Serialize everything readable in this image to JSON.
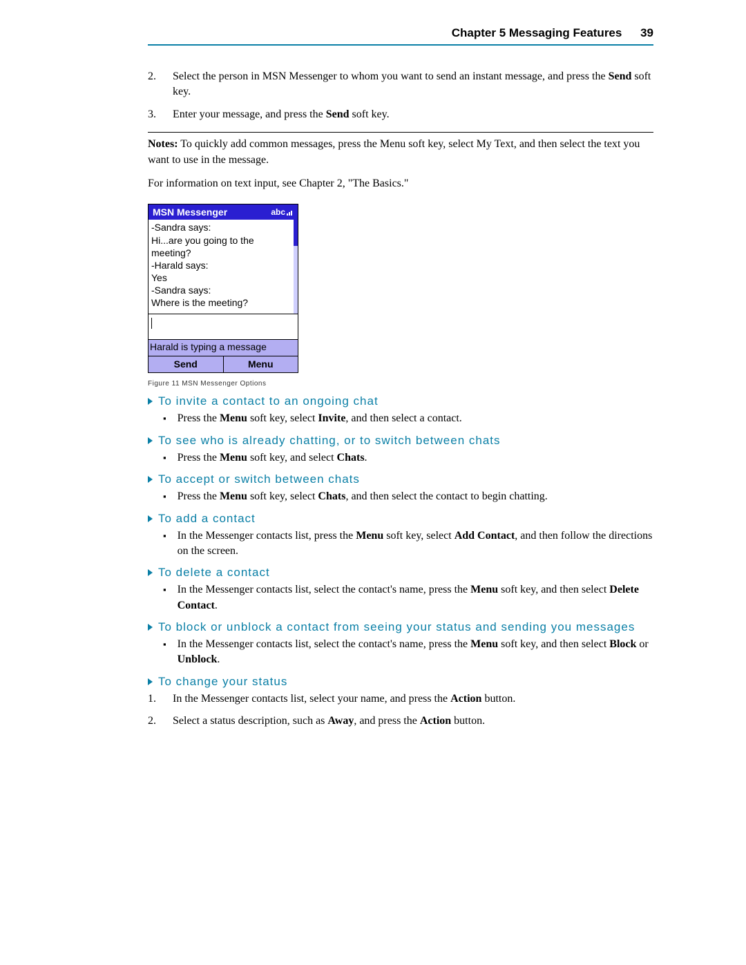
{
  "header": {
    "title": "Chapter 5 Messaging Features",
    "page": "39"
  },
  "steps_top": [
    {
      "n": "2.",
      "text_before": "Select the person in MSN Messenger to whom you want to send an instant message, and press the ",
      "bold": "Send",
      "text_after": " soft key."
    },
    {
      "n": "3.",
      "text_before": "Enter your message, and press the ",
      "bold": "Send",
      "text_after": " soft key."
    }
  ],
  "notes": {
    "label": "Notes:",
    "text": " To quickly add common messages, press the Menu soft key, select My Text, and then select the text you want to use in the message."
  },
  "info_line": "For information on text input, see Chapter 2, \"The Basics.\"",
  "msn": {
    "title": "MSN Messenger",
    "abc": "abc",
    "lines": [
      "-Sandra says:",
      "Hi...are you going to the",
      "meeting?",
      "-Harald says:",
      "Yes",
      "-Sandra says:",
      "Where is the meeting?"
    ],
    "status": "Harald is typing a message",
    "sk_left": "Send",
    "sk_right": "Menu"
  },
  "figcaption": "Figure 11 MSN Messenger Options",
  "sections": [
    {
      "title": "To invite a contact to an ongoing chat",
      "bullets_html": [
        "Press the <b>Menu</b> soft key, select <b>Invite</b>, and then select a contact."
      ]
    },
    {
      "title": "To see who is already chatting, or to switch between chats",
      "bullets_html": [
        "Press the <b>Menu</b> soft key, and select <b>Chats</b>."
      ]
    },
    {
      "title": "To accept or switch between chats",
      "bullets_html": [
        "Press the <b>Menu</b> soft key, select <b>Chats</b>, and then select the contact to begin chatting."
      ]
    },
    {
      "title": "To add a contact",
      "bullets_html": [
        "In the Messenger contacts list, press the <b>Menu</b> soft key, select <b>Add Contact</b>, and then follow the directions on the screen."
      ]
    },
    {
      "title": "To delete a contact",
      "bullets_html": [
        "In the Messenger contacts list, select the contact's name, press the <b>Menu</b> soft key, and then select <b>Delete Contact</b>."
      ]
    },
    {
      "title": "To block or unblock a contact from seeing your status and sending you messages",
      "bullets_html": [
        "In the Messenger contacts list, select the contact's name, press the <b>Menu</b> soft key, and then select <b>Block</b>  or <b>Unblock</b>."
      ]
    },
    {
      "title": "To change your status",
      "numbered_html": [
        {
          "n": "1.",
          "html": "In the Messenger contacts list, select your name, and press the <b>Action</b> button."
        },
        {
          "n": "2.",
          "html": "Select a status description, such as <b>Away</b>, and press the <b>Action</b> button."
        }
      ]
    }
  ]
}
